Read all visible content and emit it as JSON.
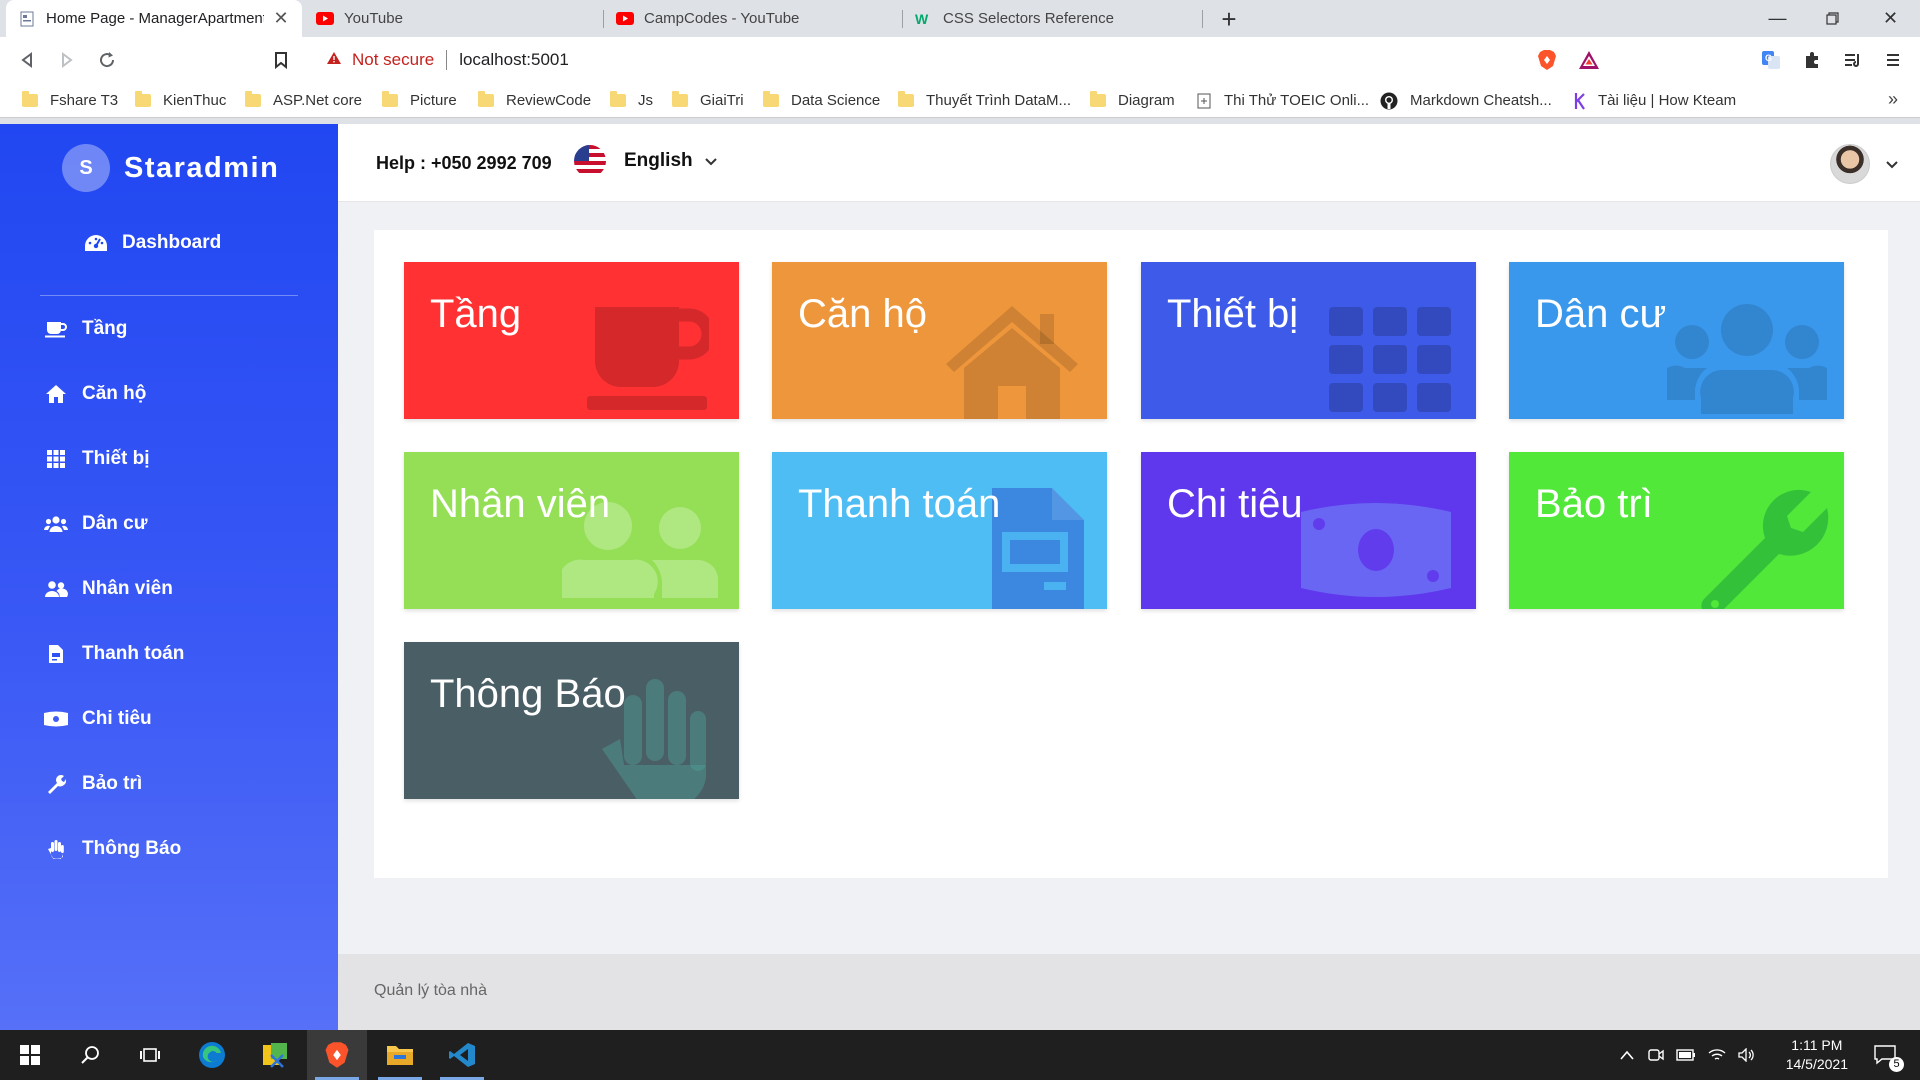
{
  "browser": {
    "tabs": [
      {
        "title": "Home Page - ManagerApartment",
        "active": true
      },
      {
        "title": "YouTube",
        "active": false
      },
      {
        "title": "CampCodes - YouTube",
        "active": false
      },
      {
        "title": "CSS Selectors Reference",
        "active": false
      }
    ],
    "address": {
      "security_label": "Not secure",
      "url": "localhost:5001"
    },
    "bookmarks": [
      "Fshare T3",
      "KienThuc",
      "ASP.Net core",
      "Picture",
      "ReviewCode",
      "Js",
      "GiaiTri",
      "Data Science",
      "Thuyết Trình DataM...",
      "Diagram",
      "Thi Thử TOEIC Onli...",
      "Markdown Cheatsh...",
      "Tài liệu | How Kteam"
    ],
    "bookmarks_more": "»"
  },
  "sidebar": {
    "brand_initial": "S",
    "brand_name": "Staradmin",
    "dashboard_label": "Dashboard",
    "items": [
      {
        "label": "Tầng",
        "icon": "coffee-icon"
      },
      {
        "label": "Căn hộ",
        "icon": "home-icon"
      },
      {
        "label": "Thiết bị",
        "icon": "grid-icon"
      },
      {
        "label": "Dân cư",
        "icon": "users-icon"
      },
      {
        "label": "Nhân viên",
        "icon": "user-friends-icon"
      },
      {
        "label": "Thanh toán",
        "icon": "invoice-icon"
      },
      {
        "label": "Chi tiêu",
        "icon": "money-bill-icon"
      },
      {
        "label": "Bảo trì",
        "icon": "wrench-icon"
      },
      {
        "label": "Thông Báo",
        "icon": "hand-icon"
      }
    ]
  },
  "topbar": {
    "help": "Help : +050 2992 709",
    "language": "English"
  },
  "tiles": [
    {
      "label": "Tầng",
      "color": "#ff3133",
      "icon": "coffee-icon"
    },
    {
      "label": "Căn hộ",
      "color": "#ee963b",
      "icon": "home-icon"
    },
    {
      "label": "Thiết bị",
      "color": "#3d5be8",
      "icon": "grid-icon"
    },
    {
      "label": "Dân cư",
      "color": "#3a98ec",
      "icon": "users-icon"
    },
    {
      "label": "Nhân viên",
      "color": "#95df57",
      "icon": "user-friends-icon"
    },
    {
      "label": "Thanh toán",
      "color": "#4ebdf4",
      "icon": "invoice-icon"
    },
    {
      "label": "Chi tiêu",
      "color": "#5f37ec",
      "icon": "money-bill-icon"
    },
    {
      "label": "Bảo trì",
      "color": "#51e83a",
      "icon": "wrench-icon"
    },
    {
      "label": "Thông Báo",
      "color": "#4a5e66",
      "icon": "hand-icon"
    }
  ],
  "footer": {
    "text": "Quản lý tòa nhà"
  },
  "taskbar": {
    "time": "1:11 PM",
    "date": "14/5/2021",
    "notification_count": "5"
  }
}
